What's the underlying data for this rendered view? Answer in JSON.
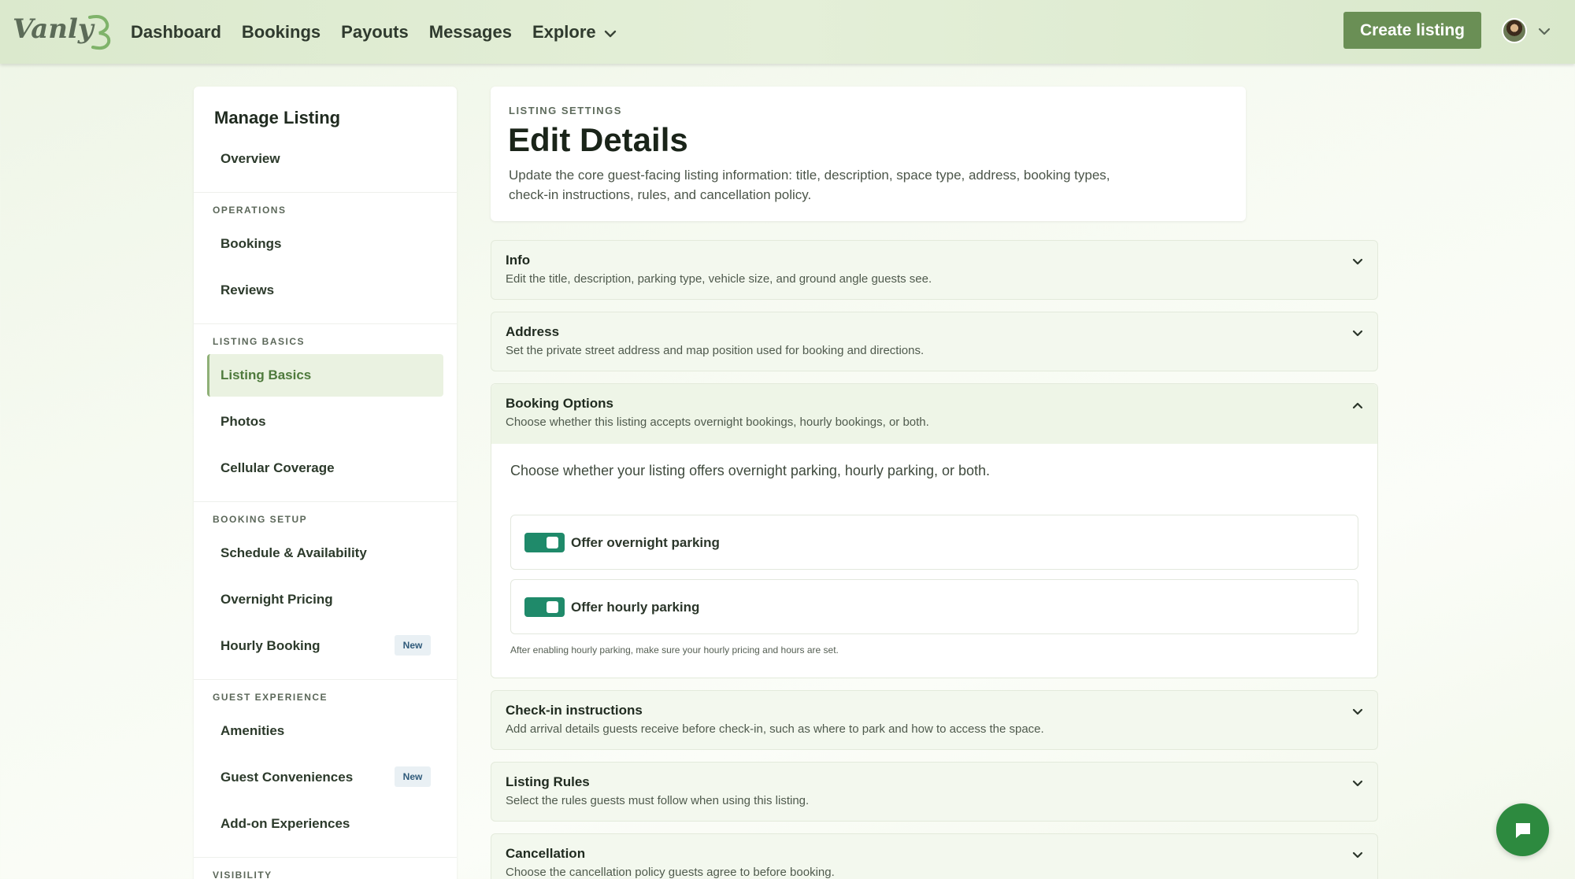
{
  "brand": {
    "logo_text": "Vanly",
    "accent": "#6a8f55",
    "toggle_color": "#1f8a6a"
  },
  "nav": {
    "items": [
      {
        "label": "Dashboard"
      },
      {
        "label": "Bookings"
      },
      {
        "label": "Payouts"
      },
      {
        "label": "Messages"
      },
      {
        "label": "Explore",
        "icon": "chevron-down-icon"
      }
    ],
    "create_button": "Create listing",
    "avatar_icon": "user-avatar",
    "avatar_menu_icon": "chevron-down-icon"
  },
  "sidebar": {
    "title": "Manage Listing",
    "overview": "Overview",
    "sections": {
      "operations": "OPERATIONS",
      "listing_basics": "LISTING BASICS",
      "booking_setup": "BOOKING SETUP",
      "guest_experience": "GUEST EXPERIENCE",
      "visibility": "VISIBILITY"
    },
    "items": {
      "bookings": "Bookings",
      "reviews": "Reviews",
      "listing_basics": "Listing Basics",
      "photos": "Photos",
      "cellular_coverage": "Cellular Coverage",
      "schedule": "Schedule & Availability",
      "overnight_pricing": "Overnight Pricing",
      "hourly_booking": "Hourly Booking",
      "amenities": "Amenities",
      "guest_conveniences": "Guest Conveniences",
      "addon_experiences": "Add-on Experiences"
    },
    "badge_new": "New",
    "active": "Listing Basics"
  },
  "header": {
    "eyebrow": "LISTING SETTINGS",
    "title": "Edit Details",
    "description": "Update the core guest-facing listing information: title, description, space type, address, booking types, check-in instructions, rules, and cancellation policy."
  },
  "sections": {
    "info": {
      "title": "Info",
      "subtitle": "Edit the title, description, parking type, vehicle size, and ground angle guests see."
    },
    "address": {
      "title": "Address",
      "subtitle": "Set the private street address and map position used for booking and directions."
    },
    "booking_options": {
      "title": "Booking Options",
      "subtitle": "Choose whether this listing accepts overnight bookings, hourly bookings, or both.",
      "intro": "Choose whether your listing offers overnight parking, hourly parking, or both.",
      "overnight_label": "Offer overnight parking",
      "overnight_enabled": true,
      "hourly_label": "Offer hourly parking",
      "hourly_enabled": true,
      "hint": "After enabling hourly parking, make sure your hourly pricing and hours are set."
    },
    "checkin": {
      "title": "Check-in instructions",
      "subtitle": "Add arrival details guests receive before check-in, such as where to park and how to access the space."
    },
    "rules": {
      "title": "Listing Rules",
      "subtitle": "Select the rules guests must follow when using this listing."
    },
    "cancellation": {
      "title": "Cancellation",
      "subtitle": "Choose the cancellation policy guests agree to before booking."
    }
  },
  "chat": {
    "icon": "chat-bubble-icon"
  }
}
